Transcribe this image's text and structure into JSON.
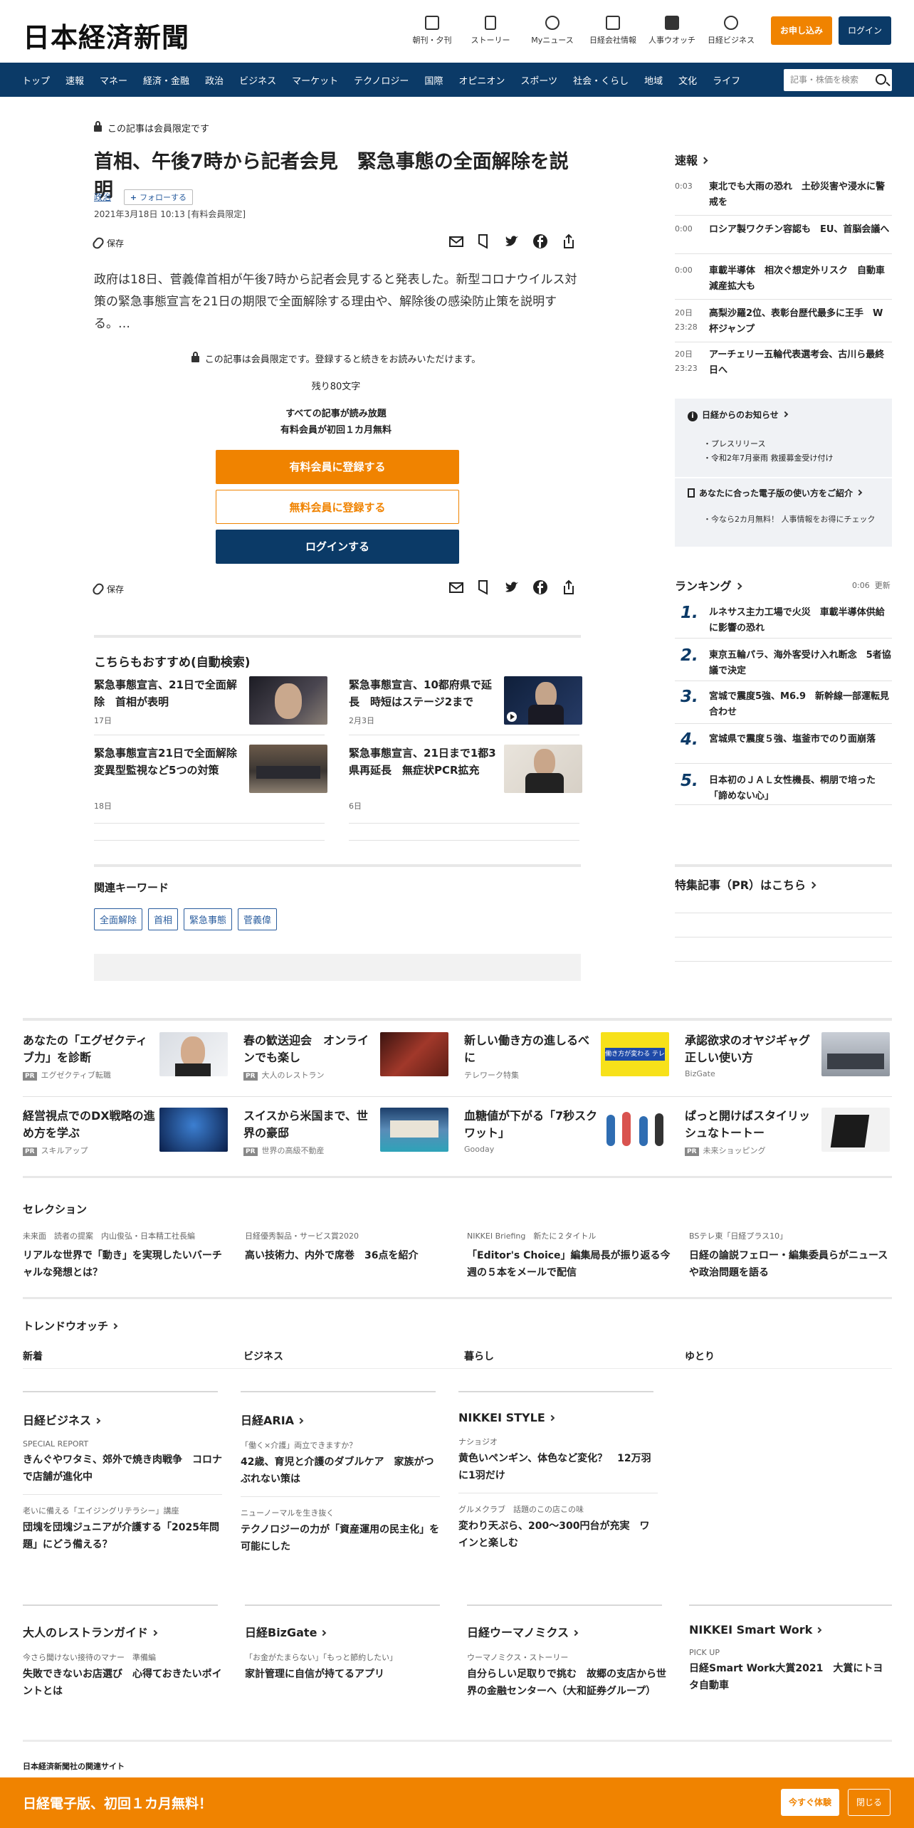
{
  "header": {
    "logo": "日本経済新聞",
    "utilities": [
      "朝刊・夕刊",
      "ストーリー",
      "Myニュース",
      "日経会社情報",
      "人事ウオッチ",
      "日経ビジネス"
    ],
    "apply_label": "お申し込み",
    "login_label": "ログイン"
  },
  "nav": {
    "items": [
      "トップ",
      "速報",
      "マネー",
      "経済・金融",
      "政治",
      "ビジネス",
      "マーケット",
      "テクノロジー",
      "国際",
      "オピニオン",
      "スポーツ",
      "社会・くらし",
      "地域",
      "文化",
      "ライフ"
    ],
    "search_placeholder": "記事・株価を検索"
  },
  "article": {
    "member_only": "この記事は会員限定です",
    "title": "首相、午後7時から記者会見　緊急事態の全面解除を説明",
    "tag": "政治",
    "follow_label": "フォローする",
    "date": "2021年3月18日 10:13 [有料会員限定]",
    "save_label": "保存",
    "lead": "政府は18日、菅義偉首相が午後7時から記者会見すると発表した。新型コロナウイルス対策の緊急事態宣言を21日の期限で全面解除する理由や、解除後の感染防止策を説明する。…",
    "lock_note": "この記事は会員限定です。登録すると続きをお読みいただけます。",
    "remaining": "残り80文字",
    "promo_line1": "すべての記事が読み放題",
    "promo_line2": "有料会員が初回１カ月無料",
    "paid_signup": "有料会員に登録する",
    "free_signup": "無料会員に登録する",
    "login": "ログインする"
  },
  "recommend": {
    "title": "こちらもおすすめ(自動検索)",
    "items": [
      {
        "title": "緊急事態宣言、21日で全面解除　首相が表明",
        "date": "17日"
      },
      {
        "title": "緊急事態宣言、10都府県で延長　時短はステージ2まで",
        "date": "2月3日"
      },
      {
        "title": "緊急事態宣言21日で全面解除　変異型監視など5つの対策",
        "date": "18日"
      },
      {
        "title": "緊急事態宣言、21日まで1都3県再延長　無症状PCR拡充",
        "date": "6日"
      }
    ]
  },
  "keywords": {
    "title": "関連キーワード",
    "items": [
      "全面解除",
      "首相",
      "緊急事態",
      "菅義偉"
    ]
  },
  "sidebar": {
    "flash_title": "速報",
    "flash": [
      {
        "time": "0:03",
        "headline": "東北でも大雨の恐れ　土砂災害や浸水に警戒を"
      },
      {
        "time": "0:00",
        "headline": "ロシア製ワクチン容認も　EU、首脳会議へ"
      },
      {
        "time": "0:00",
        "headline": "車載半導体　相次ぐ想定外リスク　自動車　減産拡大も"
      },
      {
        "time": "20日 23:28",
        "headline": "高梨沙羅2位、表彰台歴代最多に王手　W杯ジャンプ"
      },
      {
        "time": "20日 23:23",
        "headline": "アーチェリー五輪代表選考会、古川ら最終日へ"
      }
    ],
    "notice_title": "日経からのお知らせ",
    "notice_items": [
      "プレスリリース",
      "令和2年7月豪雨 救援募金受け付け"
    ],
    "edition_title": "あなたに合った電子版の使い方をご紹介",
    "edition_items": [
      "今なら2カ月無料！ 人事情報をお得にチェック"
    ],
    "ranking_title": "ランキング",
    "ranking_time": "0:06",
    "ranking_update": "更新",
    "ranking": [
      {
        "rank": "1.",
        "headline": "ルネサス主力工場で火災　車載半導体供給に影響の恐れ"
      },
      {
        "rank": "2.",
        "headline": "東京五輪パラ、海外客受け入れ断念　5者協議で決定"
      },
      {
        "rank": "3.",
        "headline": "宮城で震度5強、M6.9　新幹線一部運転見合わせ"
      },
      {
        "rank": "4.",
        "headline": "宮城県で震度５強、塩釜市でのり面崩落"
      },
      {
        "rank": "5.",
        "headline": "日本初のＪＡＬ女性機長、桐朋で培った「諦めない心」"
      }
    ],
    "pr_title": "特集記事（PR）はこちら"
  },
  "pr_grid": {
    "badge": "PR",
    "items": [
      {
        "title": "あなたの「エグゼクティブ力」を診断",
        "source": "エグゼクティブ転職",
        "pr": true
      },
      {
        "title": "春の歓送迎会　オンラインでも楽し",
        "source": "大人のレストラン",
        "pr": true
      },
      {
        "title": "新しい働き方の進しるべに",
        "source": "テレワーク特集",
        "pr": false
      },
      {
        "title": "承認欲求のオヤジギャグ　正しい使い方",
        "source": "BizGate",
        "pr": false
      },
      {
        "title": "経営視点でのDX戦略の進め方を学ぶ",
        "source": "スキルアップ",
        "pr": true
      },
      {
        "title": "スイスから米国まで、世界の豪邸",
        "source": "世界の高級不動産",
        "pr": true
      },
      {
        "title": "血糖値が下がる「7秒スクワット」",
        "source": "Gooday",
        "pr": false
      },
      {
        "title": "ぱっと開けばスタイリッシュなトートー",
        "source": "未来ショッピング",
        "pr": true
      }
    ],
    "banner_text": "働き方が変わる テレワーク特集"
  },
  "selection": {
    "title": "セレクション",
    "items": [
      {
        "kicker": "未来面　読者の提案　内山俊弘・日本精工社長編",
        "title": "リアルな世界で「動き」を実現したいバーチャルな発想とは？"
      },
      {
        "kicker": "日経優秀製品・サービス賞2020",
        "title": "高い技術力、内外で席巻　36点を紹介"
      },
      {
        "kicker": "NIKKEI Briefing　新たに２タイトル",
        "title": "「Editor's Choice」編集局長が振り返る今週の５本をメールで配信"
      },
      {
        "kicker": "BSテレ東「日経プラス10」",
        "title": "日経の論説フェロー・編集委員らがニュースや政治問題を語る"
      }
    ]
  },
  "trend": {
    "title": "トレンドウオッチ",
    "tabs": [
      "新着",
      "ビジネス",
      "暮らし",
      "ゆとり"
    ]
  },
  "magazines": [
    {
      "name": "日経ビジネス",
      "entries": [
        {
          "kicker": "SPECIAL REPORT",
          "title": "きんぐやワタミ、郊外で焼き肉戦争　コロナで店舗が進化中"
        },
        {
          "kicker": "老いに備える「エイジングリテラシー」講座",
          "title": "団塊を団塊ジュニアが介護する「2025年問題」にどう備える？"
        }
      ]
    },
    {
      "name": "日経ARIA",
      "entries": [
        {
          "kicker": "「働く×介護」両立できますか？",
          "title": "42歳、育児と介護のダブルケア　家族がつぶれない策は"
        },
        {
          "kicker": "ニューノーマルを生き抜く",
          "title": "テクノロジーの力が「資産運用の民主化」を可能にした"
        }
      ]
    },
    {
      "name": "NIKKEI STYLE",
      "entries": [
        {
          "kicker": "ナショジオ",
          "title": "黄色いペンギン、体色など変化？　12万羽に1羽だけ"
        },
        {
          "kicker": "グルメクラブ　話題のこの店この味",
          "title": "変わり天ぷら、200～300円台が充実　ワインと楽しむ"
        }
      ]
    }
  ],
  "partners": [
    {
      "name": "大人のレストランガイド",
      "kicker": "今さら聞けない接待のマナー　準備編",
      "title": "失敗できないお店選び　心得ておきたいポイントとは"
    },
    {
      "name": "日経BizGate",
      "kicker": "「お金がたまらない」「もっと節約したい」",
      "title": "家計管理に自信が持てるアプリ"
    },
    {
      "name": "日経ウーマノミクス",
      "kicker": "ウーマノミクス・ストーリー",
      "title": "自分らしい足取りで挑む　故郷の支店から世界の金融センターへ（大和証券グループ）"
    },
    {
      "name": "NIKKEI Smart Work",
      "kicker": "PICK UP",
      "title": "日経Smart Work大賞2021　大賞にトヨタ自動車"
    }
  ],
  "footer": {
    "related_sites": "日本経済新聞社の関連サイト"
  },
  "bottom_bar": {
    "text": "日経電子版、初回１カ月無料！",
    "try_label": "今すぐ体験",
    "close_label": "閉じる"
  }
}
